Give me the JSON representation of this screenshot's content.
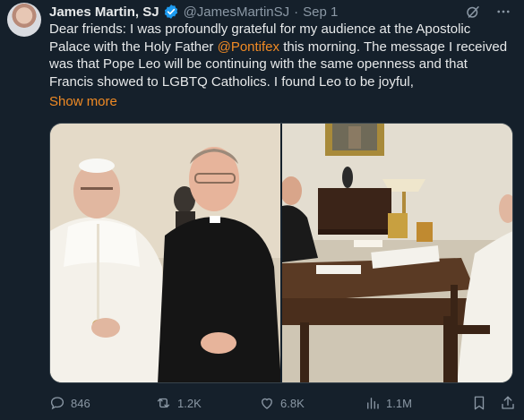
{
  "tweet": {
    "author_name": "James Martin, SJ",
    "handle": "@JamesMartinSJ",
    "separator": "·",
    "date": "Sep 1",
    "text_before_mention": "Dear friends: I was profoundly grateful for my audience at the Apostolic Palace with the Holy Father ",
    "mention": "@Pontifex",
    "text_after_mention": "  this morning. The message I received was that Pope Leo will be continuing with the same openness and that Francis showed to LGBTQ Catholics. I found Leo to be joyful,",
    "show_more": "Show more"
  },
  "icons": {
    "verified": "verified-badge-icon",
    "grok": "grok-icon",
    "more": "more-options-icon",
    "reply": "reply-icon",
    "retweet": "retweet-icon",
    "like": "like-icon",
    "views": "views-icon",
    "bookmark": "bookmark-icon",
    "share": "share-icon"
  },
  "actions": {
    "replies": "846",
    "retweets": "1.2K",
    "likes": "6.8K",
    "views": "1.1M"
  },
  "colors": {
    "background": "#15202b",
    "text": "#e7e9ea",
    "secondary": "#8b98a5",
    "accent": "#f08a24",
    "verified": "#1d9bf0"
  }
}
